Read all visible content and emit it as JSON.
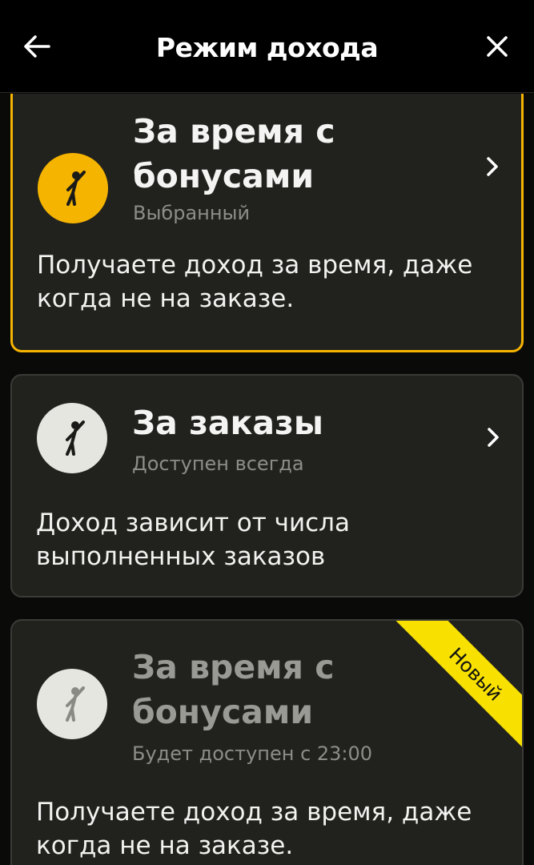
{
  "header": {
    "title": "Режим дохода",
    "back_icon": "arrow-left-icon",
    "close_icon": "close-icon"
  },
  "colors": {
    "accent": "#f5b400",
    "badge": "#f8e100",
    "card_bg": "#21211e",
    "muted_icon_bg": "#e6e6e0"
  },
  "cards": [
    {
      "title_line1": "За время с",
      "title_line2": "бонусами",
      "subtitle": "Выбранный",
      "description_line1": "Получаете доход за время, даже",
      "description_line2": "когда не на заказе.",
      "state": "selected",
      "icon": "person-waving-icon"
    },
    {
      "title_line1": "За заказы",
      "subtitle": "Доступен всегда",
      "description_line1": "Доход зависит от числа",
      "description_line2": "выполненных заказов",
      "state": "available",
      "icon": "person-waving-icon"
    },
    {
      "title_line1": "За время с",
      "title_line2": "бонусами",
      "subtitle": "Будет доступен с 23:00",
      "description_line1": "Получаете доход за время, даже",
      "description_line2": "когда не на заказе.",
      "state": "disabled",
      "badge": "Новый",
      "icon": "person-waving-icon"
    }
  ]
}
